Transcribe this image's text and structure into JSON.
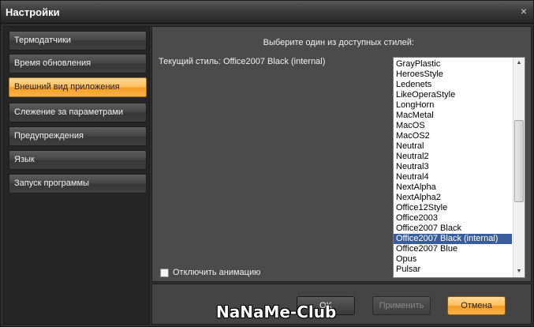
{
  "window": {
    "title": "Настройки",
    "close_icon": "×"
  },
  "sidebar": {
    "items": [
      {
        "label": "Термодатчики"
      },
      {
        "label": "Время обновления"
      },
      {
        "label": "Внешний вид приложения"
      },
      {
        "label": "Слежение за параметрами"
      },
      {
        "label": "Предупреждения"
      },
      {
        "label": "Язык"
      },
      {
        "label": "Запуск программы"
      }
    ],
    "active_index": 2
  },
  "content": {
    "prompt": "Выберите один из доступных стилей:",
    "current_style": "Текущий стиль: Office2007 Black (internal)",
    "styles": [
      "GrayPlastic",
      "HeroesStyle",
      "Ledenets",
      "LikeOperaStyle",
      "LongHorn",
      "MacMetal",
      "MacOS",
      "MacOS2",
      "Neutral",
      "Neutral2",
      "Neutral3",
      "Neutral4",
      "NextAlpha",
      "NextAlpha2",
      "Office12Style",
      "Office2003",
      "Office2007 Black",
      "Office2007 Black (internal)",
      "Office2007 Blue",
      "Opus",
      "Pulsar"
    ],
    "selected_style_index": 17,
    "disable_animation_label": "Отключить анимацию",
    "disable_animation_checked": false
  },
  "footer": {
    "ok_label": "OK",
    "apply_label": "Применить",
    "cancel_label": "Отмена"
  },
  "watermark": "NaNaMe-Club",
  "colors": {
    "accent": "#f7b24a",
    "selection": "#3a5d9c"
  }
}
